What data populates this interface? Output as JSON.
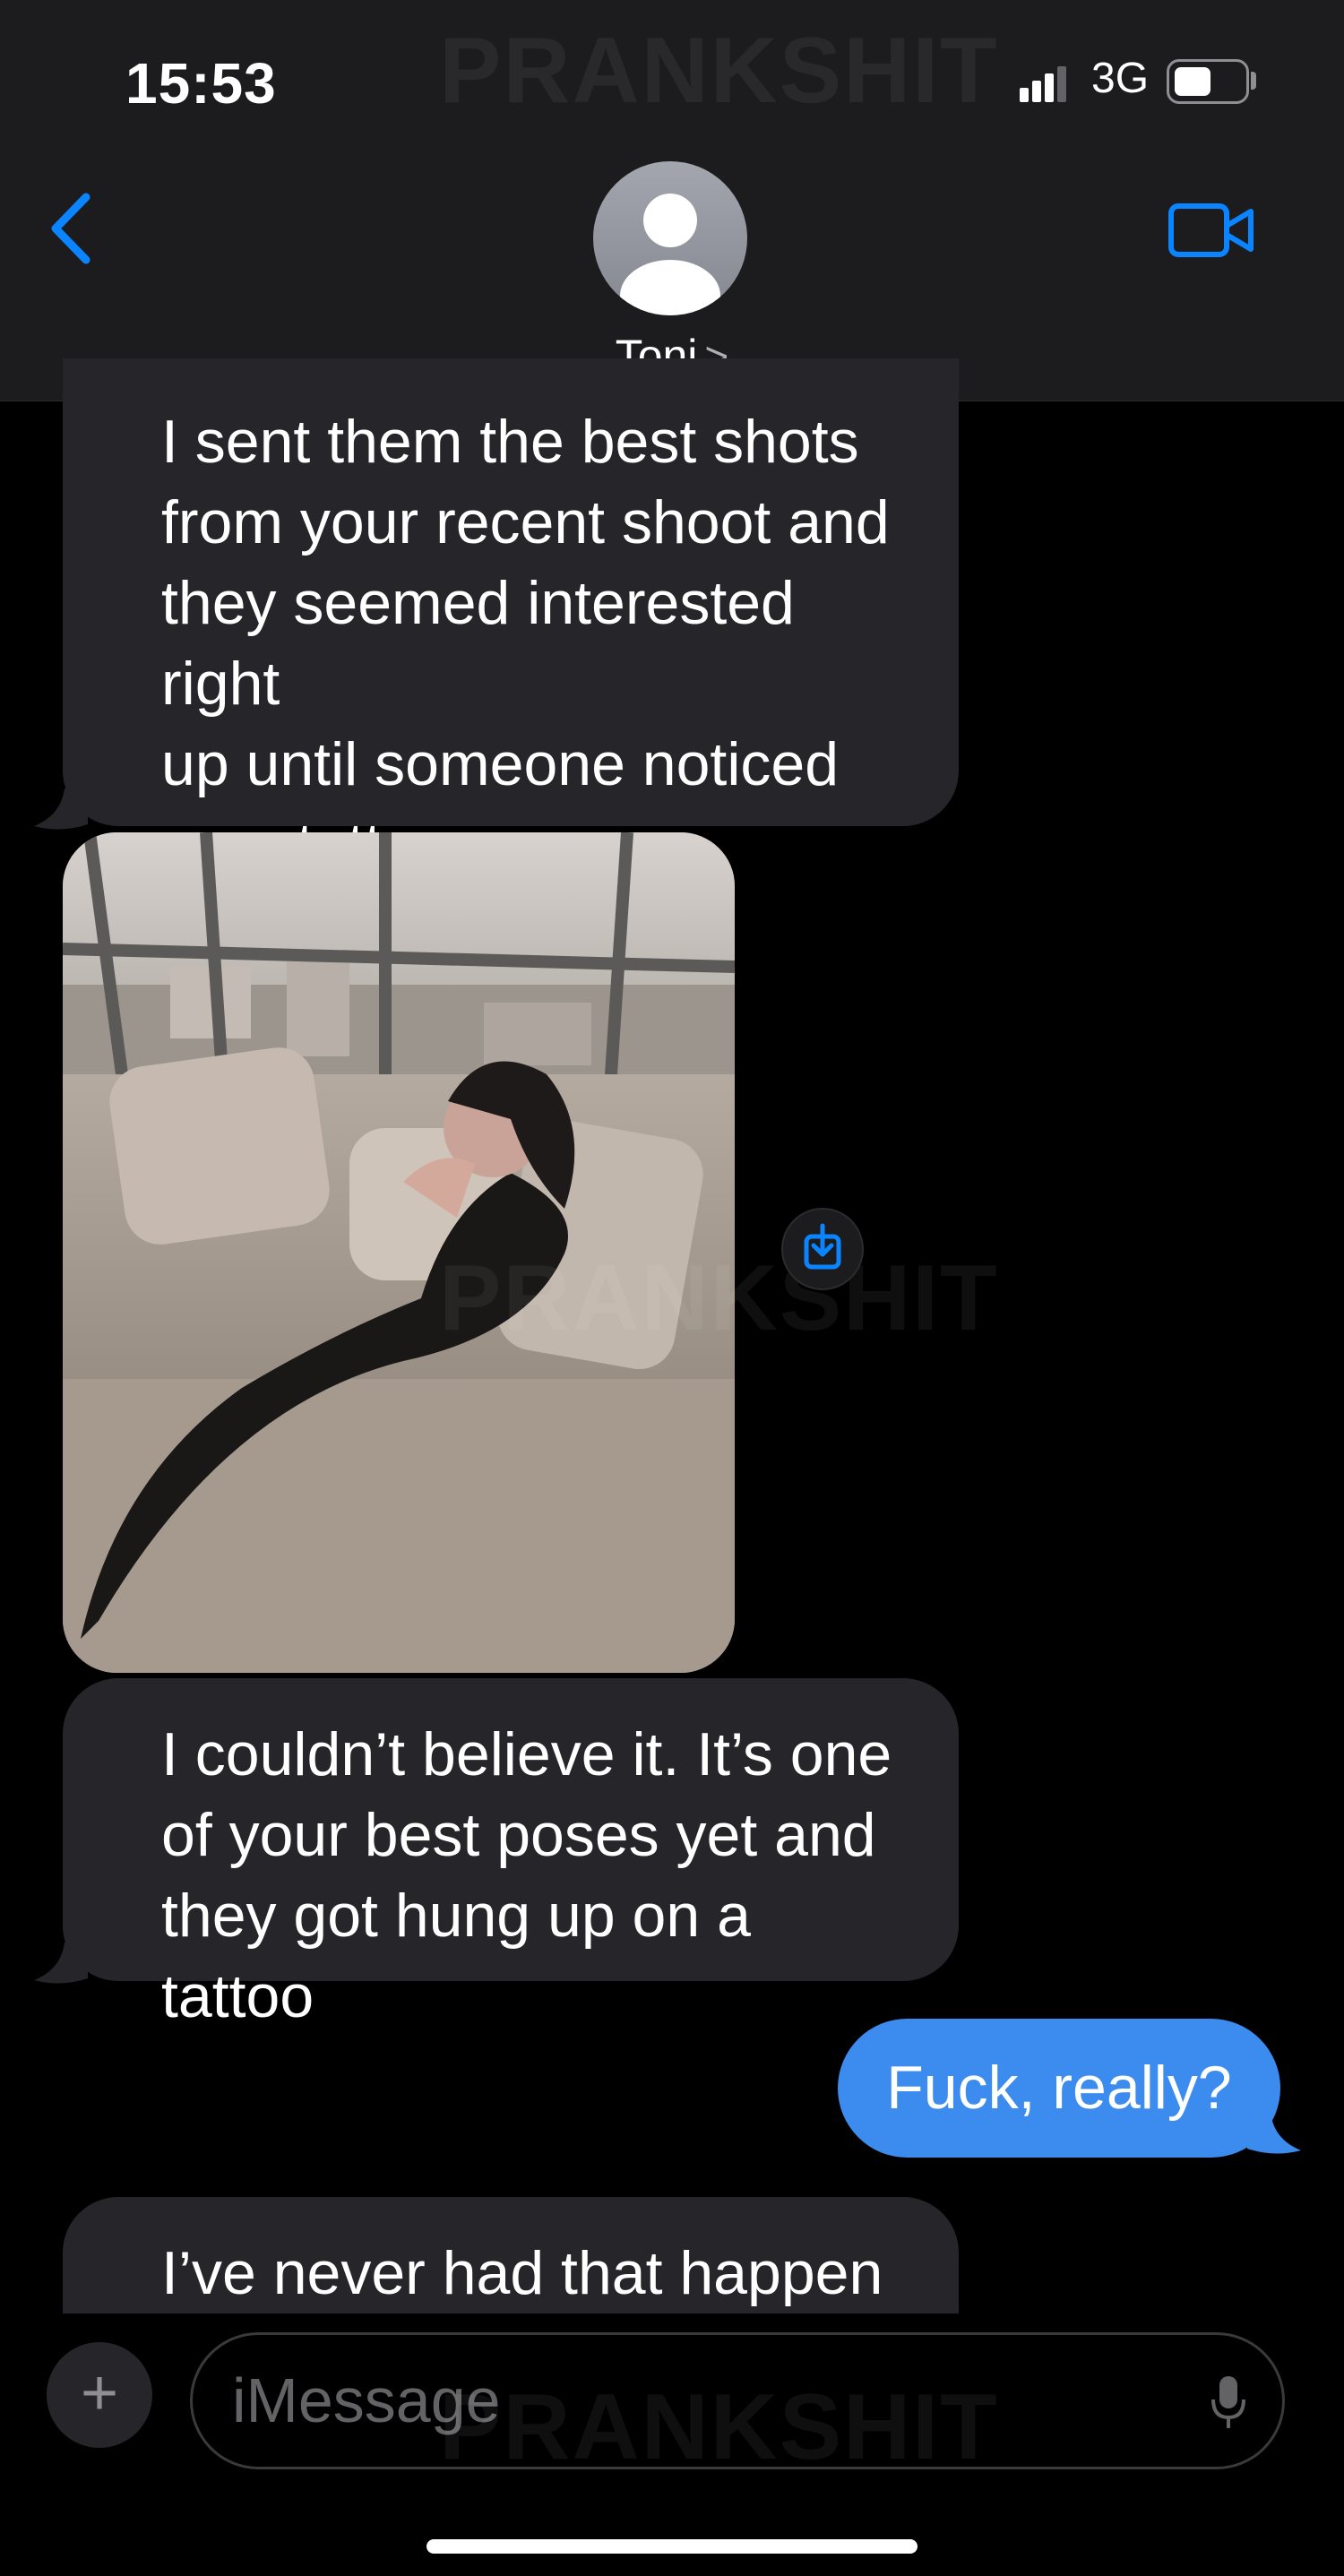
{
  "status_bar": {
    "time": "15:53",
    "network": "3G"
  },
  "watermark": "PRANKSHIT",
  "header": {
    "contact_name": "Toni",
    "chevron": ">"
  },
  "messages": [
    {
      "direction": "incoming",
      "lines": [
        "I sent them the best shots",
        "from your recent shoot and",
        "they seemed interested right",
        "up until someone noticed",
        "your tattoos"
      ]
    },
    {
      "direction": "incoming",
      "type": "image"
    },
    {
      "direction": "incoming",
      "lines": [
        "I couldn’t believe it. It’s one",
        "of your best poses yet and",
        "they got hung up on a tattoo"
      ]
    },
    {
      "direction": "outgoing",
      "text": "Fuck, really?"
    },
    {
      "direction": "incoming",
      "lines": [
        "I’ve never had that happen"
      ]
    }
  ],
  "composer": {
    "placeholder": "iMessage",
    "plus": "+"
  },
  "colors": {
    "incoming_bubble": "#26252a",
    "outgoing_bubble": "#3c8cf0",
    "accent": "#0a84ff",
    "header_bg": "#1c1c1e"
  },
  "icons": [
    "back-chevron-icon",
    "avatar-icon",
    "video-call-icon",
    "download-icon",
    "plus-icon",
    "mic-icon",
    "signal-icon",
    "battery-icon"
  ]
}
